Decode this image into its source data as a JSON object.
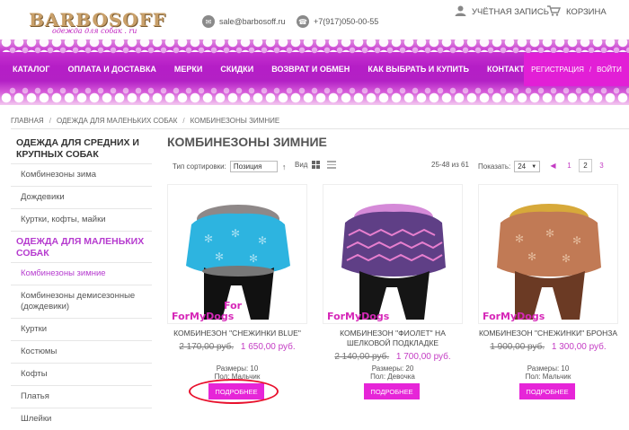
{
  "header": {
    "logo_text": "BARBOSOFF",
    "logo_tagline": "одежда для собак . ru",
    "email": "sale@barbosoff.ru",
    "phone": "+7(917)050-00-55",
    "account_label": "УЧЁТНАЯ ЗАПИСЬ",
    "cart_label": "КОРЗИНА"
  },
  "nav": {
    "items": [
      "КАТАЛОГ",
      "ОПЛАТА И ДОСТАВКА",
      "МЕРКИ",
      "СКИДКИ",
      "ВОЗВРАТ И ОБМЕН",
      "КАК ВЫБРАТЬ И КУПИТЬ",
      "КОНТАКТЫ"
    ],
    "register": "РЕГИСТРАЦИЯ",
    "login": "ВОЙТИ"
  },
  "breadcrumb": [
    "ГЛАВНАЯ",
    "ОДЕЖДА ДЛЯ МАЛЕНЬКИХ СОБАК",
    "КОМБИНЕЗОНЫ ЗИМНИЕ"
  ],
  "sidebar": {
    "group1": "ОДЕЖДА ДЛЯ СРЕДНИХ И КРУПНЫХ СОБАК",
    "group1_items": [
      "Комбинезоны зима",
      "Дождевики",
      "Куртки, кофты, майки"
    ],
    "group2": "ОДЕЖДА ДЛЯ МАЛЕНЬКИХ СОБАК",
    "group2_items": [
      "Комбинезоны зимние",
      "Комбинезоны демисезонные (дождевики)",
      "Куртки",
      "Костюмы",
      "Кофты",
      "Платья",
      "Шлейки"
    ]
  },
  "page_title": "КОМБИНЕЗОНЫ ЗИМНИЕ",
  "toolbar": {
    "sort_label": "Тип сортировки:",
    "sort_value": "Позиция",
    "view_label": "Вид",
    "range_text": "25-48 из 61",
    "show_label": "Показать:",
    "show_value": "24",
    "pages": [
      "1",
      "2",
      "3"
    ],
    "current_page": "2"
  },
  "products": [
    {
      "name": "КОМБИНЕЗОН \"СНЕЖИНКИ BLUE\"",
      "old_price": "2 170,00 руб.",
      "new_price": "1 650,00 руб.",
      "sizes": "Размеры: 10",
      "gender": "Пол: Мальчик",
      "button": "ПОДРОБНЕЕ",
      "brand": "For My Dogs"
    },
    {
      "name": "КОМБИНЕЗОН \"ФИОЛЕТ\" НА ШЕЛКОВОЙ ПОДКЛАДКЕ",
      "old_price": "2 140,00 руб.",
      "new_price": "1 700,00 руб.",
      "sizes": "Размеры: 20",
      "gender": "Пол: Девочка",
      "button": "ПОДРОБНЕЕ",
      "brand": "For My Dogs"
    },
    {
      "name": "КОМБИНЕЗОН \"СНЕЖИНКИ\" БРОНЗА",
      "old_price": "1 900,00 руб.",
      "new_price": "1 300,00 руб.",
      "sizes": "Размеры: 10",
      "gender": "Пол: Мальчик",
      "button": "ПОДРОБНЕЕ",
      "brand": "For My Dogs"
    }
  ],
  "colors": {
    "accent": "#e625d8",
    "band": "#b51ec6",
    "link": "#c43dc4",
    "highlight_ring": "#e8112d"
  }
}
